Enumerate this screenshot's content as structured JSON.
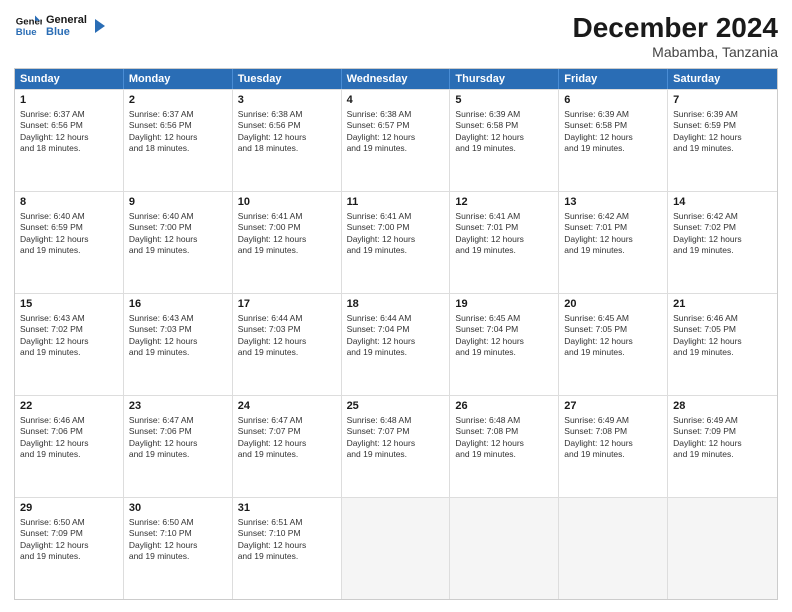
{
  "logo": {
    "line1": "General",
    "line2": "Blue"
  },
  "title": "December 2024",
  "subtitle": "Mabamba, Tanzania",
  "header_days": [
    "Sunday",
    "Monday",
    "Tuesday",
    "Wednesday",
    "Thursday",
    "Friday",
    "Saturday"
  ],
  "weeks": [
    [
      {
        "day": "1",
        "info": "Sunrise: 6:37 AM\nSunset: 6:56 PM\nDaylight: 12 hours\nand 18 minutes."
      },
      {
        "day": "2",
        "info": "Sunrise: 6:37 AM\nSunset: 6:56 PM\nDaylight: 12 hours\nand 18 minutes."
      },
      {
        "day": "3",
        "info": "Sunrise: 6:38 AM\nSunset: 6:56 PM\nDaylight: 12 hours\nand 18 minutes."
      },
      {
        "day": "4",
        "info": "Sunrise: 6:38 AM\nSunset: 6:57 PM\nDaylight: 12 hours\nand 19 minutes."
      },
      {
        "day": "5",
        "info": "Sunrise: 6:39 AM\nSunset: 6:58 PM\nDaylight: 12 hours\nand 19 minutes."
      },
      {
        "day": "6",
        "info": "Sunrise: 6:39 AM\nSunset: 6:58 PM\nDaylight: 12 hours\nand 19 minutes."
      },
      {
        "day": "7",
        "info": "Sunrise: 6:39 AM\nSunset: 6:59 PM\nDaylight: 12 hours\nand 19 minutes."
      }
    ],
    [
      {
        "day": "8",
        "info": "Sunrise: 6:40 AM\nSunset: 6:59 PM\nDaylight: 12 hours\nand 19 minutes."
      },
      {
        "day": "9",
        "info": "Sunrise: 6:40 AM\nSunset: 7:00 PM\nDaylight: 12 hours\nand 19 minutes."
      },
      {
        "day": "10",
        "info": "Sunrise: 6:41 AM\nSunset: 7:00 PM\nDaylight: 12 hours\nand 19 minutes."
      },
      {
        "day": "11",
        "info": "Sunrise: 6:41 AM\nSunset: 7:00 PM\nDaylight: 12 hours\nand 19 minutes."
      },
      {
        "day": "12",
        "info": "Sunrise: 6:41 AM\nSunset: 7:01 PM\nDaylight: 12 hours\nand 19 minutes."
      },
      {
        "day": "13",
        "info": "Sunrise: 6:42 AM\nSunset: 7:01 PM\nDaylight: 12 hours\nand 19 minutes."
      },
      {
        "day": "14",
        "info": "Sunrise: 6:42 AM\nSunset: 7:02 PM\nDaylight: 12 hours\nand 19 minutes."
      }
    ],
    [
      {
        "day": "15",
        "info": "Sunrise: 6:43 AM\nSunset: 7:02 PM\nDaylight: 12 hours\nand 19 minutes."
      },
      {
        "day": "16",
        "info": "Sunrise: 6:43 AM\nSunset: 7:03 PM\nDaylight: 12 hours\nand 19 minutes."
      },
      {
        "day": "17",
        "info": "Sunrise: 6:44 AM\nSunset: 7:03 PM\nDaylight: 12 hours\nand 19 minutes."
      },
      {
        "day": "18",
        "info": "Sunrise: 6:44 AM\nSunset: 7:04 PM\nDaylight: 12 hours\nand 19 minutes."
      },
      {
        "day": "19",
        "info": "Sunrise: 6:45 AM\nSunset: 7:04 PM\nDaylight: 12 hours\nand 19 minutes."
      },
      {
        "day": "20",
        "info": "Sunrise: 6:45 AM\nSunset: 7:05 PM\nDaylight: 12 hours\nand 19 minutes."
      },
      {
        "day": "21",
        "info": "Sunrise: 6:46 AM\nSunset: 7:05 PM\nDaylight: 12 hours\nand 19 minutes."
      }
    ],
    [
      {
        "day": "22",
        "info": "Sunrise: 6:46 AM\nSunset: 7:06 PM\nDaylight: 12 hours\nand 19 minutes."
      },
      {
        "day": "23",
        "info": "Sunrise: 6:47 AM\nSunset: 7:06 PM\nDaylight: 12 hours\nand 19 minutes."
      },
      {
        "day": "24",
        "info": "Sunrise: 6:47 AM\nSunset: 7:07 PM\nDaylight: 12 hours\nand 19 minutes."
      },
      {
        "day": "25",
        "info": "Sunrise: 6:48 AM\nSunset: 7:07 PM\nDaylight: 12 hours\nand 19 minutes."
      },
      {
        "day": "26",
        "info": "Sunrise: 6:48 AM\nSunset: 7:08 PM\nDaylight: 12 hours\nand 19 minutes."
      },
      {
        "day": "27",
        "info": "Sunrise: 6:49 AM\nSunset: 7:08 PM\nDaylight: 12 hours\nand 19 minutes."
      },
      {
        "day": "28",
        "info": "Sunrise: 6:49 AM\nSunset: 7:09 PM\nDaylight: 12 hours\nand 19 minutes."
      }
    ],
    [
      {
        "day": "29",
        "info": "Sunrise: 6:50 AM\nSunset: 7:09 PM\nDaylight: 12 hours\nand 19 minutes."
      },
      {
        "day": "30",
        "info": "Sunrise: 6:50 AM\nSunset: 7:10 PM\nDaylight: 12 hours\nand 19 minutes."
      },
      {
        "day": "31",
        "info": "Sunrise: 6:51 AM\nSunset: 7:10 PM\nDaylight: 12 hours\nand 19 minutes."
      },
      {
        "day": "",
        "info": ""
      },
      {
        "day": "",
        "info": ""
      },
      {
        "day": "",
        "info": ""
      },
      {
        "day": "",
        "info": ""
      }
    ]
  ]
}
